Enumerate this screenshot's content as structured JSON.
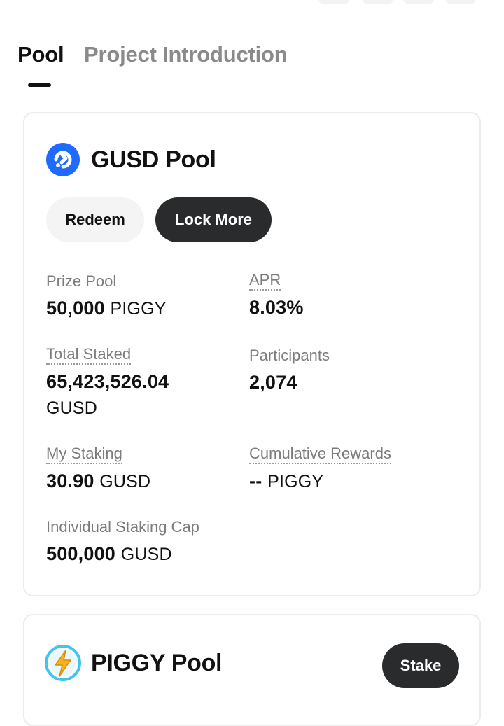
{
  "tabs": {
    "pool": "Pool",
    "project_intro": "Project Introduction"
  },
  "gusd_pool": {
    "title": "GUSD Pool",
    "icon": "gusd-coin-icon",
    "redeem_label": "Redeem",
    "lock_more_label": "Lock More",
    "stats": {
      "prize_pool": {
        "label": "Prize Pool",
        "value": "50,000",
        "unit": "PIGGY"
      },
      "apr": {
        "label": "APR",
        "value": "8.03%"
      },
      "total_staked": {
        "label": "Total Staked",
        "value": "65,423,526.04",
        "unit": "GUSD"
      },
      "participants": {
        "label": "Participants",
        "value": "2,074"
      },
      "my_staking": {
        "label": "My Staking",
        "value": "30.90",
        "unit": "GUSD"
      },
      "cumulative_rewards": {
        "label": "Cumulative Rewards",
        "value": "--",
        "unit": "PIGGY"
      },
      "staking_cap": {
        "label": "Individual Staking Cap",
        "value": "500,000",
        "unit": "GUSD"
      }
    }
  },
  "piggy_pool": {
    "title": "PIGGY Pool",
    "icon": "piggy-lightning-coin-icon",
    "stake_label": "Stake"
  },
  "colors": {
    "primary_text": "#111111",
    "muted_text": "#7c7c7c",
    "inactive_tab": "#8a8a8a",
    "dark_button": "#2a2b2d",
    "light_button": "#f4f4f4",
    "gusd_blue": "#1f6bff",
    "piggy_yellow": "#f6b21a",
    "piggy_cyan": "#3fc6f0"
  }
}
